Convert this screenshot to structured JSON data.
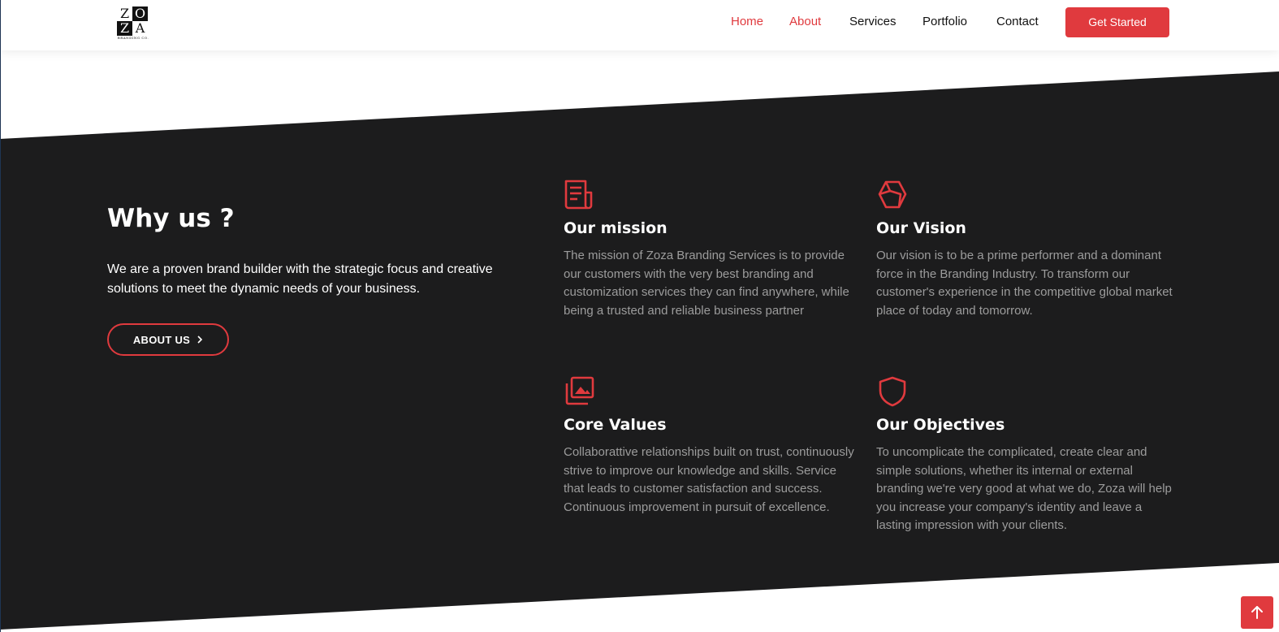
{
  "brand": {
    "logo_letters": [
      "Z",
      "O",
      "Z",
      "A"
    ],
    "logo_subtitle": "BRANDING CO.",
    "accent_color": "#e03a3e",
    "dark_color": "#1c1c1d"
  },
  "nav": {
    "items": [
      {
        "label": "Home",
        "active": true
      },
      {
        "label": "About",
        "active": true
      },
      {
        "label": "Services",
        "active": false
      },
      {
        "label": "Portfolio",
        "active": false
      },
      {
        "label": "Contact",
        "active": false
      }
    ],
    "cta_label": "Get Started"
  },
  "why": {
    "title": "Why us ?",
    "text": "We are a proven brand builder with the strategic focus and creative solutions to meet the dynamic needs of your business.",
    "button_label": "ABOUT US",
    "button_icon": "chevron-right-icon"
  },
  "cards": [
    {
      "icon": "newspaper-icon",
      "title": "Our mission",
      "text": "The mission of Zoza Branding Services is to provide our customers with the very best branding and customization services they can find anywhere, while being a trusted and reliable business partner"
    },
    {
      "icon": "box-icon",
      "title": "Our Vision",
      "text": "Our vision is to be a prime performer and a dominant force in the Branding Industry. To transform our customer's experience in the competitive global market place of today and tomorrow."
    },
    {
      "icon": "images-icon",
      "title": "Core Values",
      "text": "Collaborattive relationships built on trust, continuously strive to improve our knowledge and skills. Service that leads to customer satisfaction and success. Continuous improvement in pursuit of excellence."
    },
    {
      "icon": "shield-icon",
      "title": "Our Objectives",
      "text": "To uncomplicate the complicated, create clear and simple solutions, whether its internal or external branding we're very good at what we do, Zoza will help you increase your company's identity and leave a lasting impression with your clients."
    }
  ],
  "back_to_top_icon": "arrow-up-icon"
}
